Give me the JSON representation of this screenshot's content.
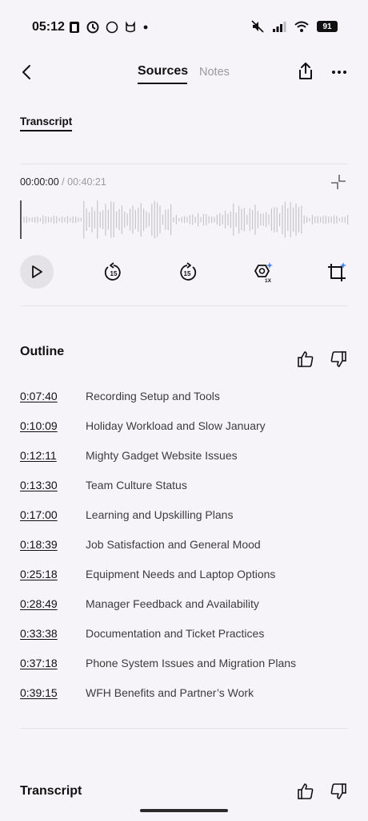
{
  "status_bar": {
    "time": "05:12",
    "battery": "91"
  },
  "top_nav": {
    "tabs": [
      {
        "label": "Sources",
        "active": true
      },
      {
        "label": "Notes",
        "active": false
      }
    ]
  },
  "source_tab": {
    "label": "Transcript"
  },
  "player": {
    "current_time": "00:00:00",
    "separator": "/",
    "total_time": "00:40:21",
    "rewind_label": "15",
    "forward_label": "15",
    "speed_label": "1X",
    "progress": 0
  },
  "outline": {
    "title": "Outline",
    "items": [
      {
        "time": "0:07:40",
        "title": "Recording Setup and Tools"
      },
      {
        "time": "0:10:09",
        "title": "Holiday Workload and Slow January"
      },
      {
        "time": "0:12:11",
        "title": "Mighty Gadget Website Issues"
      },
      {
        "time": "0:13:30",
        "title": "Team Culture Status"
      },
      {
        "time": "0:17:00",
        "title": "Learning and Upskilling Plans"
      },
      {
        "time": "0:18:39",
        "title": "Job Satisfaction and General Mood"
      },
      {
        "time": "0:25:18",
        "title": "Equipment Needs and Laptop Options"
      },
      {
        "time": "0:28:49",
        "title": "Manager Feedback and Availability"
      },
      {
        "time": "0:33:38",
        "title": "Documentation and Ticket Practices"
      },
      {
        "time": "0:37:18",
        "title": "Phone System Issues and Migration Plans"
      },
      {
        "time": "0:39:15",
        "title": "WFH Benefits and Partner’s Work"
      }
    ]
  },
  "transcript_section": {
    "title": "Transcript"
  },
  "colors": {
    "background": "#f6f4f8",
    "text": "#1a1a1a",
    "muted": "#9a9a9a",
    "accent_sparkle": "#3b82f6"
  }
}
